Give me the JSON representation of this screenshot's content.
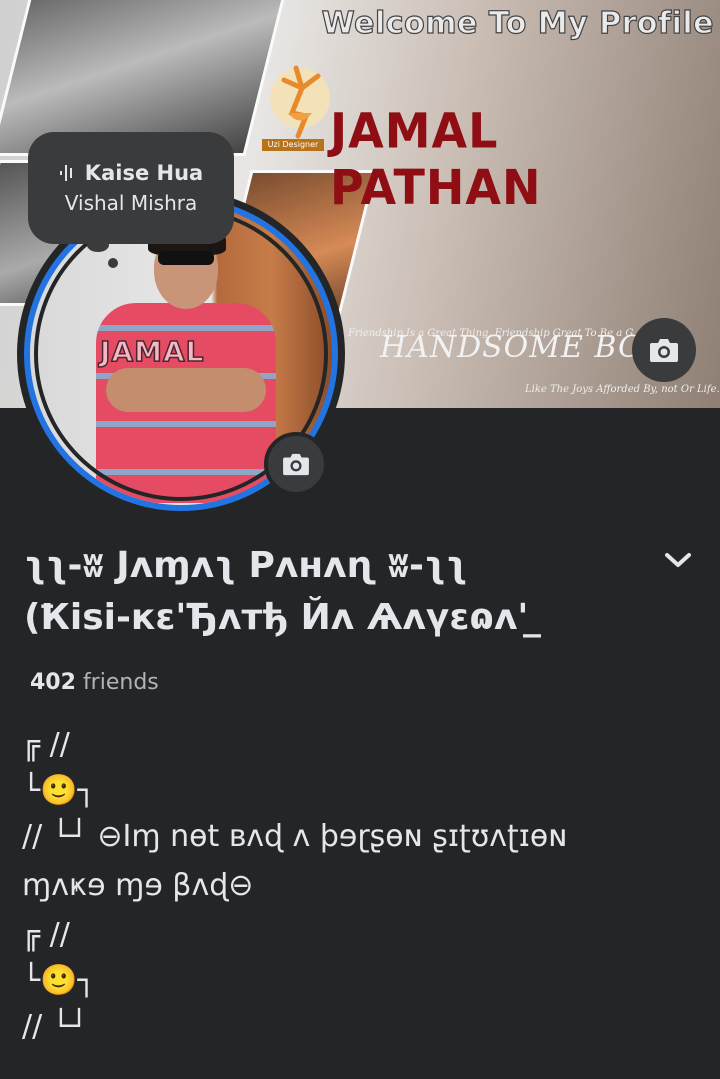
{
  "cover": {
    "title": "Welcome To My Profile",
    "name": "JAMAL PATHAN",
    "logo_label": "Uzi Designer",
    "tagline": "HANDSOME BO",
    "small_text_1": "Friendship Is a Great Thing. Friendship Great To Be a G",
    "small_text_2": "Like The Joys Afforded By, not Or Life."
  },
  "song": {
    "icon": "audio-wave-icon",
    "title": "Kaise Hua",
    "artist": "Vishal Mishra"
  },
  "avatar": {
    "label": "JAMAL",
    "ring_color": "#2374e1"
  },
  "profile": {
    "name_line1": "ʅʅ-ʬ Jʌɱʌʅ Pʌнʌɳ ʬ-ʅʅ",
    "name_line2": "(Ҟisi-кɛ'Ђʌтђ Йʌ Ѧʌүɛɷʌ' ̲ ",
    "friends_count": "402",
    "friends_label": "friends"
  },
  "bio": {
    "deco1": "╔ //",
    "deco2": "└🙂┐",
    "deco3": "// └┘",
    "quote_line1": "⊖Iɱ nɵt ʙʌɖ ʌ ϸɘɽʂɵɴ ʂɪʈʊʌʈɪɵɴ",
    "quote_line2": "ɱʌҝɘ ɱɘ βʌɖ⊖",
    "emoji": "🙂"
  },
  "colors": {
    "background": "#242526",
    "text": "#e4e6eb",
    "secondary_text": "#b0b3b8",
    "button_bg": "#3a3b3c",
    "accent": "#2374e1",
    "cover_name": "#8e0e14"
  }
}
